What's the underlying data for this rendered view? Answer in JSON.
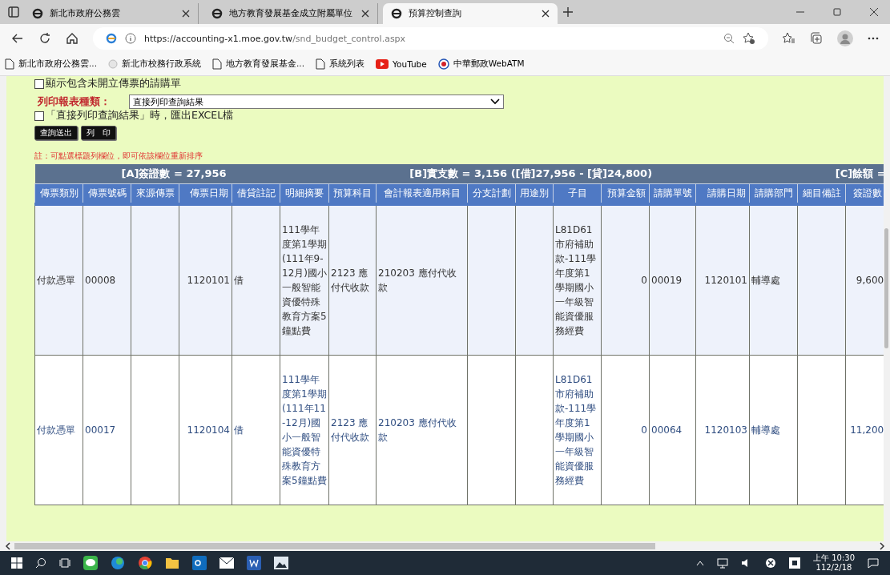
{
  "browser": {
    "tabs": [
      {
        "title": "新北市政府公務雲",
        "selected": false
      },
      {
        "title": "地方教育發展基金成立附屬單位",
        "selected": false
      },
      {
        "title": "預算控制查詢",
        "selected": true
      }
    ],
    "url": {
      "host": "https://accounting-x1.moe.gov.tw",
      "path": "/snd_budget_control.aspx"
    },
    "bookmarks": [
      {
        "label": "新北市政府公務雲..."
      },
      {
        "label": "新北市校務行政系統"
      },
      {
        "label": "地方教育發展基金..."
      },
      {
        "label": "系統列表"
      },
      {
        "label": "YouTube"
      },
      {
        "label": "中華郵政WebATM"
      }
    ]
  },
  "form": {
    "hidden_option": {
      "label": "顯示包含未開立傳票的請購單",
      "checked": false
    },
    "report_type": {
      "label": "列印報表種類：",
      "value": "直接列印查詢結果"
    },
    "excel_option": {
      "label": "「直接列印查詢結果」時，匯出EXCEL檔",
      "checked": false
    },
    "buttons": [
      "查詢送出",
      "列　印"
    ],
    "note": "註：可點選標題列欄位，即可依該欄位重新排序"
  },
  "table": {
    "summary": [
      "[A]簽證數 = 27,956",
      "[B]實支數 = 3,156 ([借]27,956 - [貸]24,800)",
      "[C]餘額 ="
    ],
    "columns": [
      {
        "label": "傳票類別",
        "kind": "text"
      },
      {
        "label": "傳票號碼",
        "kind": "text"
      },
      {
        "label": "來源傳票",
        "kind": "text"
      },
      {
        "label": "傳票日期",
        "kind": "number"
      },
      {
        "label": "借貸註記",
        "kind": "text"
      },
      {
        "label": "明細摘要",
        "kind": "text"
      },
      {
        "label": "預算科目",
        "kind": "text"
      },
      {
        "label": "會計報表適用科目",
        "kind": "text"
      },
      {
        "label": "分支計劃",
        "kind": "text"
      },
      {
        "label": "用途別",
        "kind": "text"
      },
      {
        "label": "子目",
        "kind": "text"
      },
      {
        "label": "預算金額",
        "kind": "number"
      },
      {
        "label": "請購單號",
        "kind": "text"
      },
      {
        "label": "請購日期",
        "kind": "number"
      },
      {
        "label": "請購部門",
        "kind": "text"
      },
      {
        "label": "細目備註",
        "kind": "text"
      },
      {
        "label": "簽證數",
        "kind": "number"
      }
    ],
    "rows": [
      {
        "cells": [
          "付款憑單",
          "00008",
          "",
          "1120101",
          "借",
          "111學年度第1學期(111年9-12月)國小一般智能資優特殊教育方案5鐘點費",
          "2123 應付代收款",
          "210203 應付代收款",
          "",
          "",
          "L81D61市府補助款-111學年度第1學期國小一年級智能資優服務經費",
          "0",
          "00019",
          "1120101",
          "輔導處",
          "",
          "9,600"
        ]
      },
      {
        "cells": [
          "付款憑單",
          "00017",
          "",
          "1120104",
          "借",
          "111學年度第1學期(111年11-12月)國小一般智能資優特殊教育方案5鐘點費",
          "2123 應付代收款",
          "210203 應付代收款",
          "",
          "",
          "L81D61市府補助款-111學年度第1學期國小一年級智能資優服務經費",
          "0",
          "00064",
          "1120103",
          "輔導處",
          "",
          "11,200"
        ]
      }
    ]
  },
  "taskbar": {
    "time": "上午 10:30",
    "date": "112/2/18"
  }
}
